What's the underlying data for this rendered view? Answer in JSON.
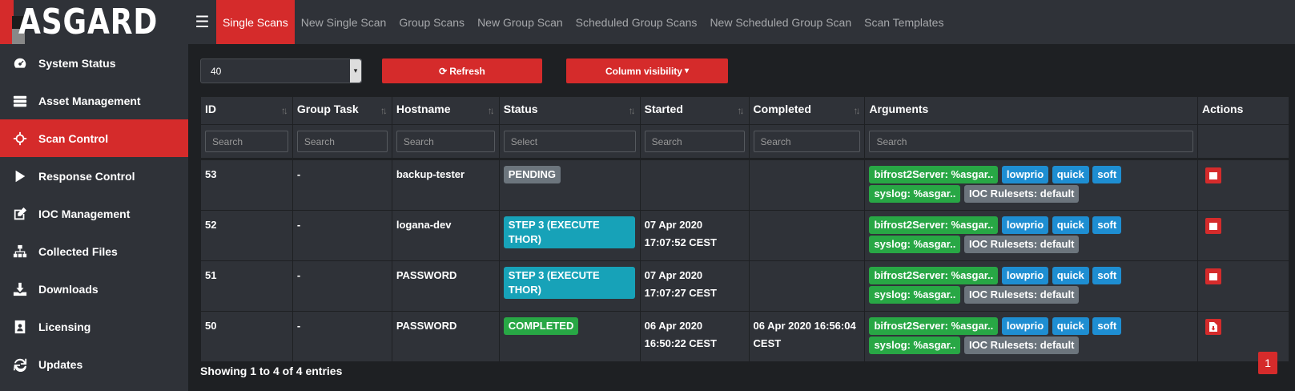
{
  "app": {
    "logo_text": "ASGARD"
  },
  "sidebar": {
    "items": [
      {
        "label": "System Status",
        "icon": "gauge-icon",
        "active": false
      },
      {
        "label": "Asset Management",
        "icon": "server-icon",
        "active": false
      },
      {
        "label": "Scan Control",
        "icon": "crosshairs-icon",
        "active": true
      },
      {
        "label": "Response Control",
        "icon": "play-icon",
        "active": false
      },
      {
        "label": "IOC Management",
        "icon": "edit-icon",
        "active": false
      },
      {
        "label": "Collected Files",
        "icon": "sitemap-icon",
        "active": false
      },
      {
        "label": "Downloads",
        "icon": "download-icon",
        "active": false
      },
      {
        "label": "Licensing",
        "icon": "id-badge-icon",
        "active": false
      },
      {
        "label": "Updates",
        "icon": "refresh-icon",
        "active": false
      }
    ]
  },
  "topbar": {
    "menu_icon": "☰",
    "tabs": [
      {
        "label": "Single Scans",
        "active": true
      },
      {
        "label": "New Single Scan",
        "active": false
      },
      {
        "label": "Group Scans",
        "active": false
      },
      {
        "label": "New Group Scan",
        "active": false
      },
      {
        "label": "Scheduled Group Scans",
        "active": false
      },
      {
        "label": "New Scheduled Group Scan",
        "active": false
      },
      {
        "label": "Scan Templates",
        "active": false
      }
    ]
  },
  "controls": {
    "page_length": "40",
    "refresh_label": "Refresh",
    "refresh_icon": "⟳",
    "colvis_label": "Column visibility",
    "colvis_caret": "▾"
  },
  "table": {
    "columns": [
      "ID",
      "Group Task",
      "Hostname",
      "Status",
      "Started",
      "Completed",
      "Arguments",
      "Actions"
    ],
    "sortable": [
      true,
      true,
      true,
      true,
      true,
      true,
      false,
      false
    ],
    "filters": [
      "Search",
      "Search",
      "Search",
      "Select",
      "Search",
      "Search",
      "Search",
      ""
    ],
    "rows": [
      {
        "id": "53",
        "group_task": "-",
        "hostname": "backup-tester",
        "status": "PENDING",
        "status_color": "#6c757d",
        "started_1": "",
        "started_2": "",
        "completed_1": "",
        "completed_2": "",
        "action": "stop"
      },
      {
        "id": "52",
        "group_task": "-",
        "hostname": "logana-dev",
        "status": "STEP 3 (EXECUTE THOR)",
        "status_color": "#17a2b8",
        "started_1": "07 Apr 2020",
        "started_2": "17:07:52 CEST",
        "completed_1": "",
        "completed_2": "",
        "action": "stop"
      },
      {
        "id": "51",
        "group_task": "-",
        "hostname": "PASSWORD",
        "status": "STEP 3 (EXECUTE THOR)",
        "status_color": "#17a2b8",
        "started_1": "07 Apr 2020",
        "started_2": "17:07:27 CEST",
        "completed_1": "",
        "completed_2": "",
        "action": "stop"
      },
      {
        "id": "50",
        "group_task": "-",
        "hostname": "PASSWORD",
        "status": "COMPLETED",
        "status_color": "#28a745",
        "started_1": "06 Apr 2020",
        "started_2": "16:50:22 CEST",
        "completed_1": "06 Apr 2020 16:56:04",
        "completed_2": "CEST",
        "action": "download"
      }
    ],
    "argument_badges": [
      {
        "text": "bifrost2Server: %asgar..",
        "color": "#28a745"
      },
      {
        "text": "lowprio",
        "color": "#1e8ed2"
      },
      {
        "text": "quick",
        "color": "#1e8ed2"
      },
      {
        "text": "soft",
        "color": "#1e8ed2"
      },
      {
        "text": "syslog: %asgar..",
        "color": "#28a745"
      },
      {
        "text": "IOC Rulesets: default",
        "color": "#6c757d"
      }
    ]
  },
  "footer": {
    "showing": "Showing 1 to 4 of 4 entries",
    "page": "1"
  }
}
